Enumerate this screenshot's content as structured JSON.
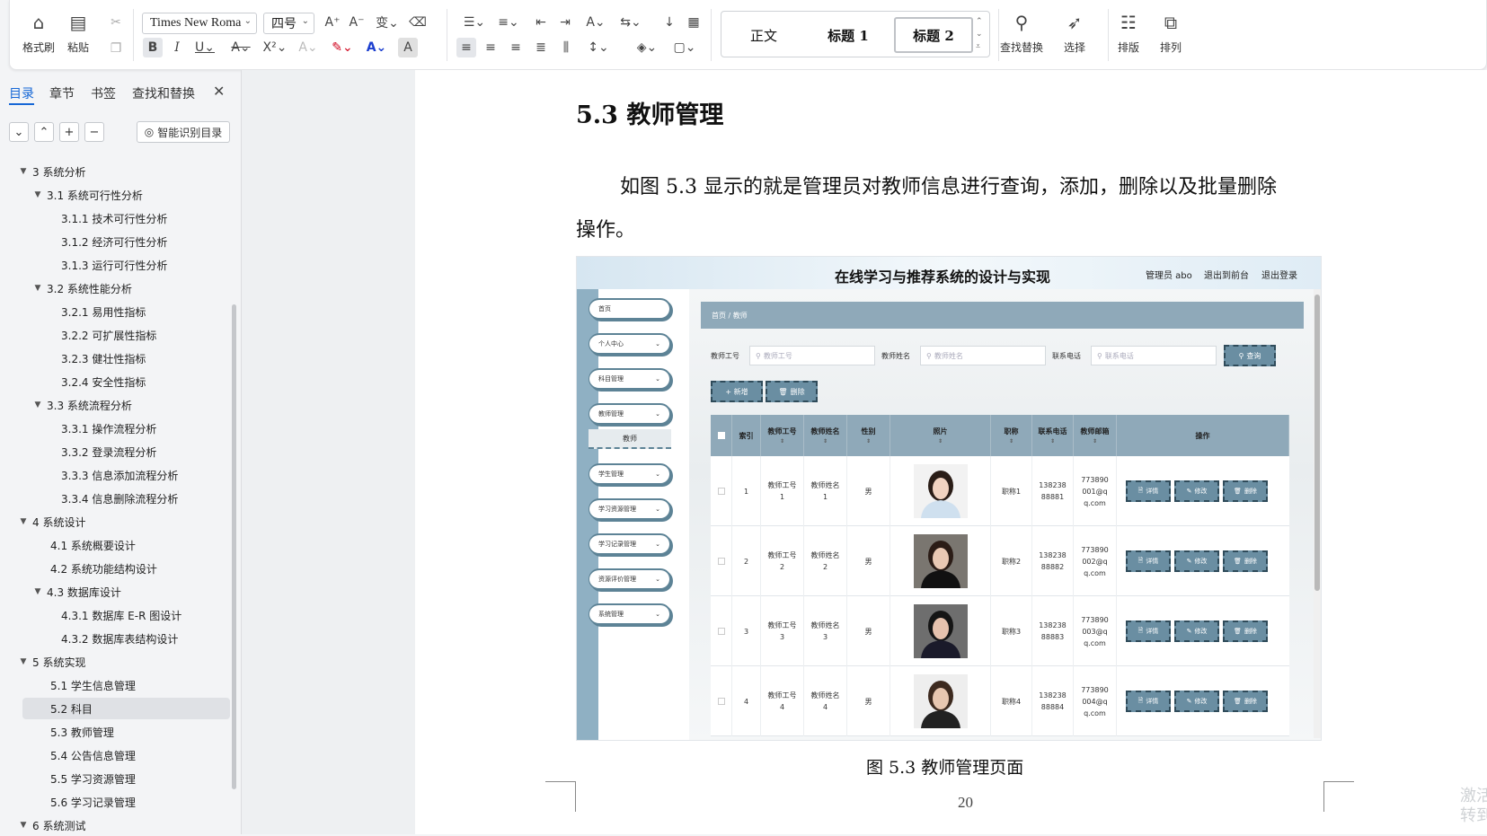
{
  "ribbon": {
    "format_painter": "格式刷",
    "paste": "粘贴",
    "font_name": "Times New Roma",
    "font_size": "四号",
    "styles": {
      "normal": "正文",
      "heading1": "标题 1",
      "heading2": "标题 2"
    },
    "find_replace": "查找替换",
    "select": "选择",
    "layout": "排版",
    "arrange": "排列"
  },
  "nav": {
    "tabs": [
      "目录",
      "章节",
      "书签",
      "查找和替换"
    ],
    "smart_toc": "智能识别目录",
    "items": [
      {
        "label": "3  系统分析",
        "level": 0,
        "expanded": true
      },
      {
        "label": "3.1  系统可行性分析",
        "level": 1,
        "expanded": true
      },
      {
        "label": "3.1.1  技术可行性分析",
        "level": 2
      },
      {
        "label": "3.1.2  经济可行性分析",
        "level": 2
      },
      {
        "label": "3.1.3  运行可行性分析",
        "level": 2
      },
      {
        "label": "3.2  系统性能分析",
        "level": 1,
        "expanded": true
      },
      {
        "label": "3.2.1  易用性指标",
        "level": 2
      },
      {
        "label": "3.2.2  可扩展性指标",
        "level": 2
      },
      {
        "label": "3.2.3  健壮性指标",
        "level": 2
      },
      {
        "label": "3.2.4  安全性指标",
        "level": 2
      },
      {
        "label": "3.3  系统流程分析",
        "level": 1,
        "expanded": true
      },
      {
        "label": "3.3.1  操作流程分析",
        "level": 2
      },
      {
        "label": "3.3.2  登录流程分析",
        "level": 2
      },
      {
        "label": "3.3.3  信息添加流程分析",
        "level": 2
      },
      {
        "label": "3.3.4  信息删除流程分析",
        "level": 2
      },
      {
        "label": "4  系统设计",
        "level": 0,
        "expanded": true
      },
      {
        "label": "4.1  系统概要设计",
        "level": 1
      },
      {
        "label": "4.2  系统功能结构设计",
        "level": 1
      },
      {
        "label": "4.3  数据库设计",
        "level": 1,
        "expanded": true
      },
      {
        "label": "4.3.1  数据库 E-R 图设计",
        "level": 2
      },
      {
        "label": "4.3.2  数据库表结构设计",
        "level": 2
      },
      {
        "label": "5  系统实现",
        "level": 0,
        "expanded": true
      },
      {
        "label": "5.1  学生信息管理",
        "level": 1
      },
      {
        "label": "5.2  科目",
        "level": 1,
        "selected": true
      },
      {
        "label": "5.3  教师管理",
        "level": 1
      },
      {
        "label": "5.4  公告信息管理",
        "level": 1
      },
      {
        "label": "5.5  学习资源管理",
        "level": 1
      },
      {
        "label": "5.6  学习记录管理",
        "level": 1
      },
      {
        "label": "6  系统测试",
        "level": 0,
        "expanded": true
      }
    ]
  },
  "doc": {
    "heading": "5.3  教师管理",
    "para_line1": "如图 5.3 显示的就是管理员对教师信息进行查询，添加，删除以及批量删除",
    "para_line2": "操作。",
    "caption": "图 5.3  教师管理页面",
    "page_number": "20"
  },
  "figure": {
    "title": "在线学习与推荐系统的设计与实现",
    "admin": "管理员 abo",
    "to_front": "退出到前台",
    "logout": "退出登录",
    "menu": [
      "首页",
      "个人中心",
      "科目管理",
      "教师管理",
      "学生管理",
      "学习资源管理",
      "学习记录管理",
      "资源评价管理",
      "系统管理"
    ],
    "submenu": "教师",
    "breadcrumb": "首页  /  教师",
    "filters": [
      {
        "label": "教师工号",
        "placeholder": "教师工号"
      },
      {
        "label": "教师姓名",
        "placeholder": "教师姓名"
      },
      {
        "label": "联系电话",
        "placeholder": "联系电话"
      }
    ],
    "search_btn": "查询",
    "add_btn": "+ 新增",
    "delete_btn": "删除",
    "columns": [
      "索引",
      "教师工号",
      "教师姓名",
      "性别",
      "照片",
      "职称",
      "联系电话",
      "教师邮箱",
      "操作"
    ],
    "rows": [
      {
        "index": "1",
        "no": "教师工号1",
        "name": "教师姓名1",
        "gender": "男",
        "title": "职称1",
        "phone": "13823888881",
        "email": "773890001@qq.com"
      },
      {
        "index": "2",
        "no": "教师工号2",
        "name": "教师姓名2",
        "gender": "男",
        "title": "职称2",
        "phone": "13823888882",
        "email": "773890002@qq.com"
      },
      {
        "index": "3",
        "no": "教师工号3",
        "name": "教师姓名3",
        "gender": "男",
        "title": "职称3",
        "phone": "13823888883",
        "email": "773890003@qq.com"
      },
      {
        "index": "4",
        "no": "教师工号4",
        "name": "教师姓名4",
        "gender": "男",
        "title": "职称4",
        "phone": "13823888884",
        "email": "773890004@qq.com"
      }
    ],
    "actions": [
      "详情",
      "修改",
      "删除"
    ]
  },
  "watermark": "激活\n转到"
}
